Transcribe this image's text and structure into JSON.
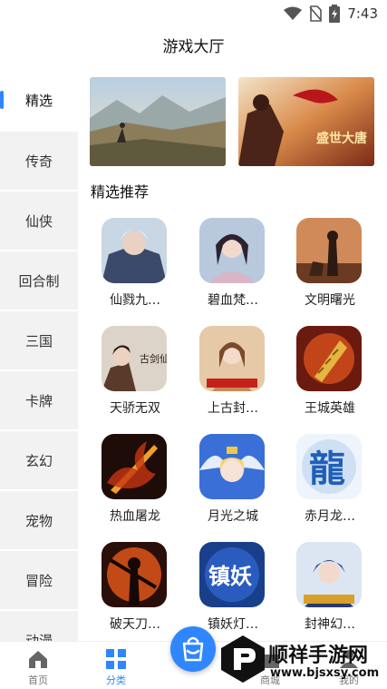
{
  "status_bar": {
    "time": "7:43"
  },
  "header": {
    "title": "游戏大厅"
  },
  "sidebar": {
    "items": [
      {
        "label": "精选",
        "active": true
      },
      {
        "label": "传奇"
      },
      {
        "label": "仙侠"
      },
      {
        "label": "回合制"
      },
      {
        "label": "三国"
      },
      {
        "label": "卡牌"
      },
      {
        "label": "玄幻"
      },
      {
        "label": "宠物"
      },
      {
        "label": "冒险"
      },
      {
        "label": "动漫"
      }
    ]
  },
  "banners": [
    {
      "name": "banner-landscape"
    },
    {
      "name": "banner-shengshi-datang",
      "text": "盛世大唐"
    }
  ],
  "section": {
    "title": "精选推荐"
  },
  "games": [
    {
      "name": "仙戮九…",
      "icon": "warrior-portrait-icon"
    },
    {
      "name": "碧血梵…",
      "icon": "fairy-portrait-icon"
    },
    {
      "name": "文明曙光",
      "icon": "hunter-with-dog-icon"
    },
    {
      "name": "天骄无双",
      "icon": "swordsman-icon",
      "icon_text": "古剑仙途"
    },
    {
      "name": "上古封…",
      "icon": "goddess-icon"
    },
    {
      "name": "王城英雄",
      "icon": "golden-drill-icon"
    },
    {
      "name": "热血屠龙",
      "icon": "fire-sword-icon"
    },
    {
      "name": "月光之城",
      "icon": "angel-girl-icon"
    },
    {
      "name": "赤月龙…",
      "icon": "dragon-logo-icon",
      "icon_text": "龍"
    },
    {
      "name": "破天刀…",
      "icon": "dark-warrior-icon"
    },
    {
      "name": "镇妖灯…",
      "icon": "zhenyao-logo-icon",
      "icon_text": "镇妖"
    },
    {
      "name": "封神幻…",
      "icon": "blue-hair-hero-icon"
    }
  ],
  "bottom_nav": [
    {
      "label": "首页",
      "icon": "home-icon"
    },
    {
      "label": "分类",
      "icon": "grid-icon",
      "active": true
    },
    {
      "label": "商城",
      "icon": "store-icon"
    },
    {
      "label": "我的",
      "icon": "user-icon"
    }
  ],
  "fab": {
    "icon": "shopping-bag-icon"
  },
  "watermark": {
    "name": "顺祥手游网",
    "url": "www.bjsxsy.com"
  },
  "colors": {
    "accent": "#2f86ff",
    "sidebar_bg": "#f2f2f2"
  }
}
